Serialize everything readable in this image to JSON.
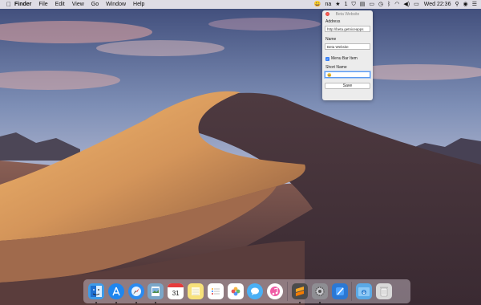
{
  "menubar": {
    "app_name": "Finder",
    "items": [
      "File",
      "Edit",
      "View",
      "Go",
      "Window",
      "Help"
    ],
    "status_text": "na",
    "clock": "Wed 22:36"
  },
  "popover": {
    "title": "Beta Website",
    "address_label": "Address",
    "address_value": "http://beta.getniceapps",
    "name_label": "Name",
    "name_value": "Beta Website",
    "menu_bar_item_label": "Menu Bar Item",
    "menu_bar_item_checked": true,
    "short_name_label": "Short Name",
    "short_name_value": "😀",
    "save_label": "Save"
  },
  "dock": {
    "calendar_day": "31",
    "apps": [
      {
        "name": "finder-icon",
        "color": "#3e9be8",
        "running": true
      },
      {
        "name": "app-store-icon",
        "color": "#1f86ee",
        "running": true
      },
      {
        "name": "safari-icon",
        "color": "#2a8af0",
        "running": true
      },
      {
        "name": "preview-icon",
        "color": "#7aa6c8",
        "running": true
      },
      {
        "name": "calendar-icon",
        "color": "#ffffff",
        "running": false
      },
      {
        "name": "notes-icon",
        "color": "#f7e17a",
        "running": false
      },
      {
        "name": "reminders-icon",
        "color": "#ffffff",
        "running": false
      },
      {
        "name": "photos-icon",
        "color": "#ffffff",
        "running": false
      },
      {
        "name": "messages-icon",
        "color": "#4ab0f5",
        "running": false
      },
      {
        "name": "itunes-icon",
        "color": "#f05ca6",
        "running": false
      },
      {
        "name": "sublime-text-icon",
        "color": "#4b4b4b",
        "running": true
      },
      {
        "name": "system-preferences-icon",
        "color": "#8e8e93",
        "running": true
      },
      {
        "name": "xcode-icon",
        "color": "#2b78d3",
        "running": false
      },
      {
        "name": "downloads-folder-icon",
        "color": "#5aa9e6",
        "running": false
      },
      {
        "name": "trash-icon",
        "color": "#d9d9d9",
        "running": false
      }
    ]
  }
}
